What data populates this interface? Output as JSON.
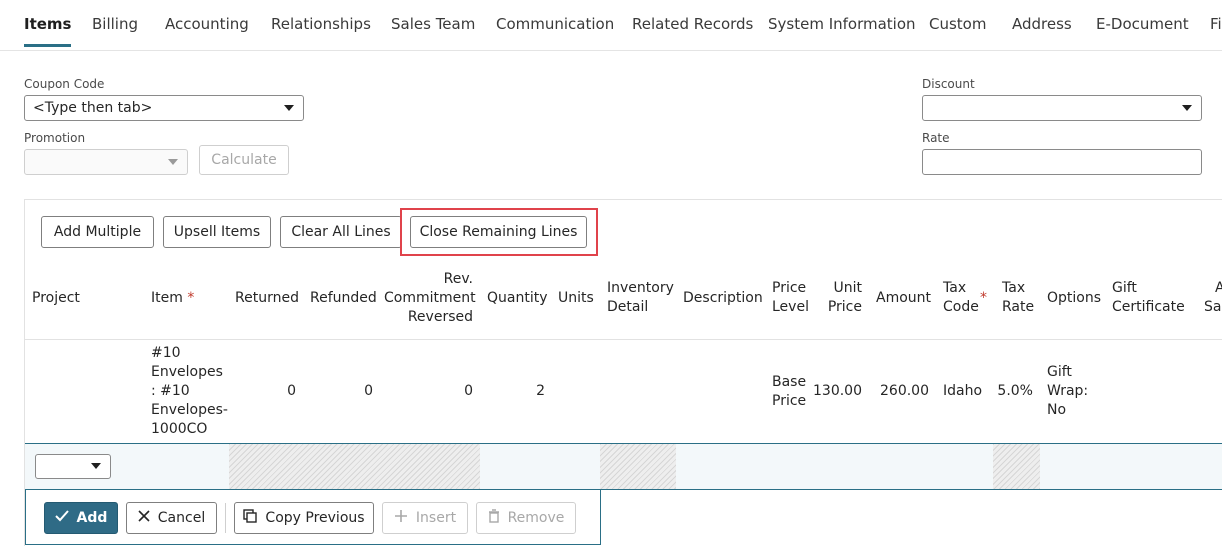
{
  "tabs": [
    {
      "label": "Items",
      "active": true
    },
    {
      "label": "Billing"
    },
    {
      "label": "Accounting"
    },
    {
      "label": "Relationships"
    },
    {
      "label": "Sales Team"
    },
    {
      "label": "Communication"
    },
    {
      "label": "Related Records"
    },
    {
      "label": "System Information"
    },
    {
      "label": "Custom"
    },
    {
      "label": "Address"
    },
    {
      "label": "E-Document"
    },
    {
      "label": "Fi"
    }
  ],
  "form": {
    "coupon_code_label": "Coupon Code",
    "coupon_code_value": "<Type then tab>",
    "promotion_label": "Promotion",
    "promotion_value": "",
    "calculate_label": "Calculate",
    "discount_label": "Discount",
    "discount_value": "",
    "rate_label": "Rate",
    "rate_value": ""
  },
  "toolbar": {
    "add_multiple": "Add Multiple",
    "upsell_items": "Upsell Items",
    "clear_all_lines": "Clear All Lines",
    "close_remaining_lines": "Close Remaining Lines"
  },
  "columns": {
    "project": "Project",
    "item": "Item",
    "returned": "Returned",
    "refunded": "Refunded",
    "rev_1": "Rev.",
    "rev_2": "Commitment",
    "rev_3": "Reversed",
    "quantity": "Quantity",
    "units": "Units",
    "inventory_1": "Inventory",
    "inventory_2": "Detail",
    "description": "Description",
    "price_level_1": "Price",
    "price_level_2": "Level",
    "unit_price_1": "Unit",
    "unit_price_2": "Price",
    "amount": "Amount",
    "tax_code_1": "Tax",
    "tax_code_2": "Code",
    "tax_rate_1": "Tax",
    "tax_rate_2": "Rate",
    "options": "Options",
    "gift_1": "Gift",
    "gift_2": "Certificate",
    "alt_1": "Alt",
    "alt_2": "Sale",
    "required_mark": "*"
  },
  "row": {
    "item_1": "#10",
    "item_2": "Envelopes",
    "item_3": ": #10",
    "item_4": "Envelopes-",
    "item_5": "1000CO",
    "returned": "0",
    "refunded": "0",
    "rev_commitment_reversed": "0",
    "quantity": "2",
    "price_level_1": "Base",
    "price_level_2": "Price",
    "unit_price": "130.00",
    "amount": "260.00",
    "tax_code": "Idaho",
    "tax_rate": "5.0%",
    "options_1": "Gift",
    "options_2": "Wrap:",
    "options_3": "No"
  },
  "line_actions": {
    "add": "Add",
    "cancel": "Cancel",
    "copy_previous": "Copy Previous",
    "insert": "Insert",
    "remove": "Remove"
  },
  "colors": {
    "accent": "#2f6b86",
    "highlight": "#e0434b",
    "required": "#c0392b"
  }
}
